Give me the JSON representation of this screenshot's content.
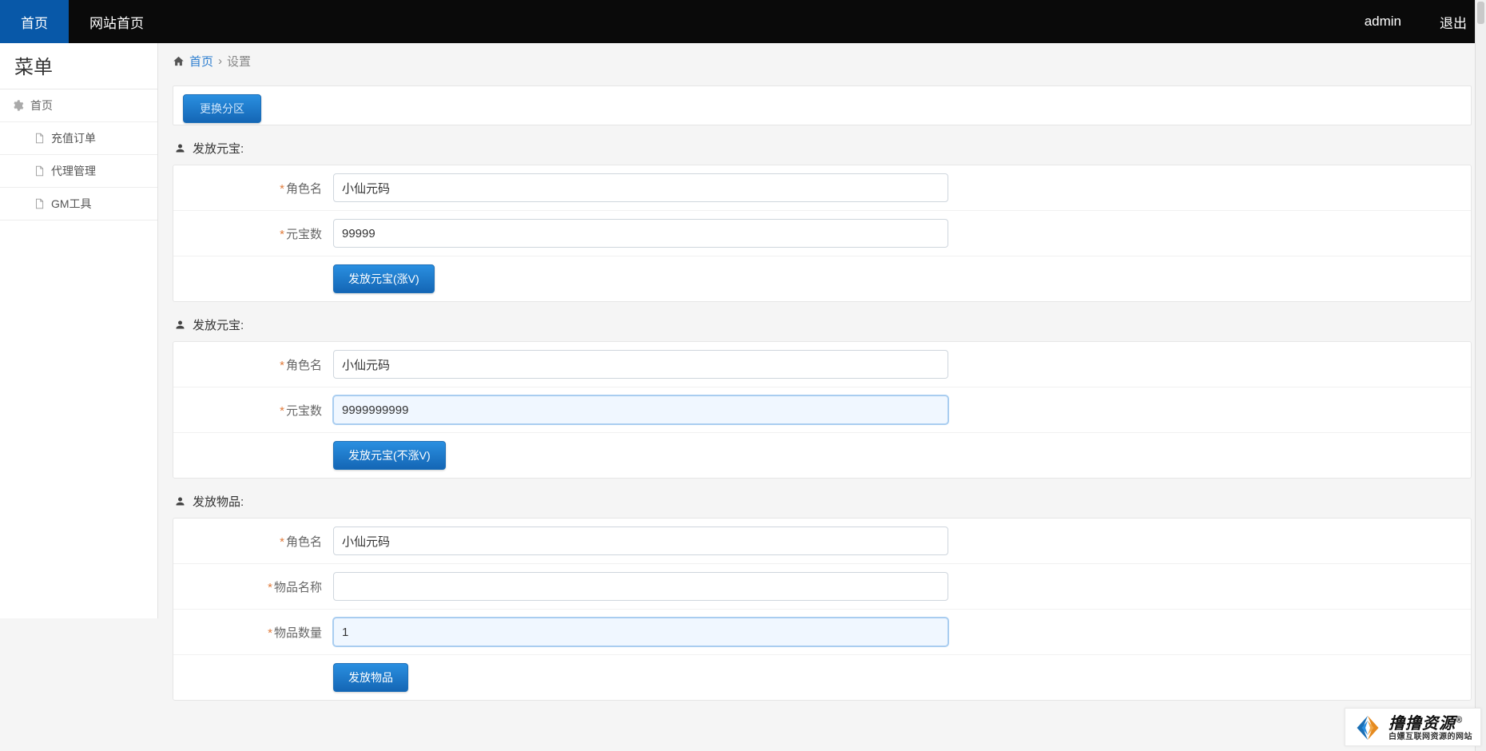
{
  "topbar": {
    "home": "首页",
    "sitehome": "网站首页",
    "user": "admin",
    "logout": "退出"
  },
  "sidebar": {
    "title": "菜单",
    "root": "首页",
    "items": [
      "充值订单",
      "代理管理",
      "GM工具"
    ]
  },
  "breadcrumb": {
    "home": "首页",
    "current": "设置",
    "sep": "›"
  },
  "zone_button": "更换分区",
  "sections": [
    {
      "title": "发放元宝:",
      "fields": [
        {
          "label": "角色名",
          "value": "小仙元码"
        },
        {
          "label": "元宝数",
          "value": "99999"
        }
      ],
      "submit": "发放元宝(涨V)"
    },
    {
      "title": "发放元宝:",
      "fields": [
        {
          "label": "角色名",
          "value": "小仙元码"
        },
        {
          "label": "元宝数",
          "value": "9999999999",
          "focused": true
        }
      ],
      "submit": "发放元宝(不涨V)"
    },
    {
      "title": "发放物品:",
      "fields": [
        {
          "label": "角色名",
          "value": "小仙元码"
        },
        {
          "label": "物品名称",
          "value": ""
        },
        {
          "label": "物品数量",
          "value": "1",
          "focused": true
        }
      ],
      "submit": "发放物品"
    }
  ],
  "watermark": {
    "main": "撸撸资源",
    "reg": "®",
    "sub": "白嫖互联网资源的网站"
  }
}
